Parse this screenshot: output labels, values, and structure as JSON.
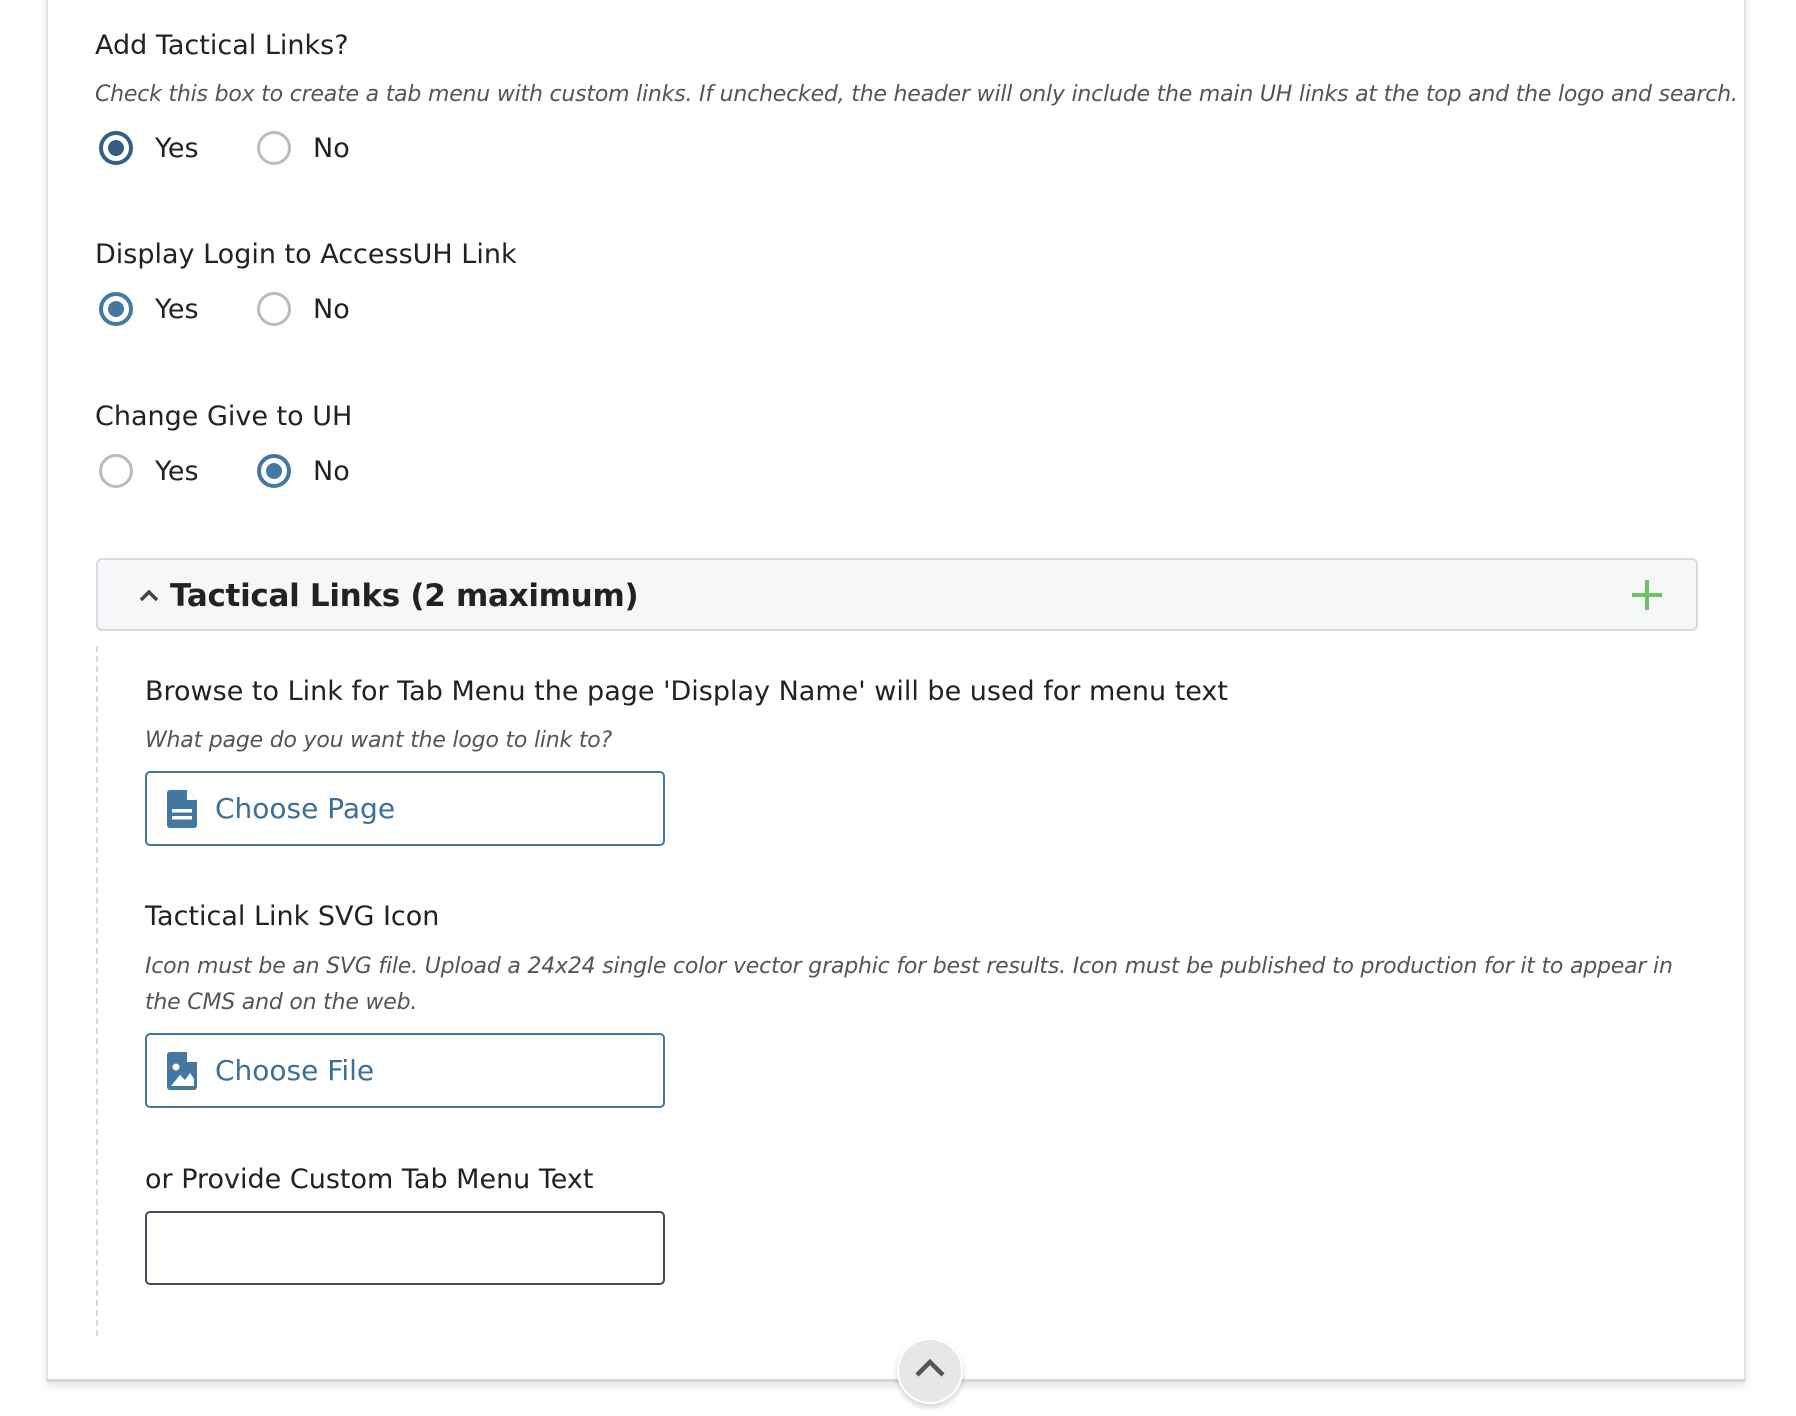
{
  "fields": {
    "add_tactical_links": {
      "label": "Add Tactical Links?",
      "help": "Check this box to create a tab menu with custom links. If unchecked, the header will only include the main UH links at the top and the logo and search.",
      "options": [
        "Yes",
        "No"
      ],
      "selected": "Yes"
    },
    "display_login": {
      "label": "Display Login to AccessUH Link",
      "options": [
        "Yes",
        "No"
      ],
      "selected": "Yes"
    },
    "change_give": {
      "label": "Change Give to UH",
      "options": [
        "Yes",
        "No"
      ],
      "selected": "No"
    }
  },
  "tactical_links": {
    "title": "Tactical Links (2 maximum)",
    "expanded": true,
    "browse_link": {
      "label": "Browse to Link for Tab Menu the page 'Display Name' will be used for menu text",
      "help": "What page do you want the logo to link to?",
      "button_label": "Choose Page",
      "icon": "file-text-icon"
    },
    "svg_icon": {
      "label": "Tactical Link SVG Icon",
      "help": "Icon must be an SVG file. Upload a 24x24 single color vector graphic for best results. Icon must be published to production for it to appear in the CMS and on the web.",
      "button_label": "Choose File",
      "icon": "file-image-icon"
    },
    "custom_text": {
      "label": "or Provide Custom Tab Menu Text",
      "value": "",
      "placeholder": ""
    }
  },
  "colors": {
    "accent": "#4578a0",
    "accent_focused": "#355e80",
    "add_green": "#6cc462",
    "radio_unchecked": "#b7bcc1",
    "help_text": "#555555"
  }
}
